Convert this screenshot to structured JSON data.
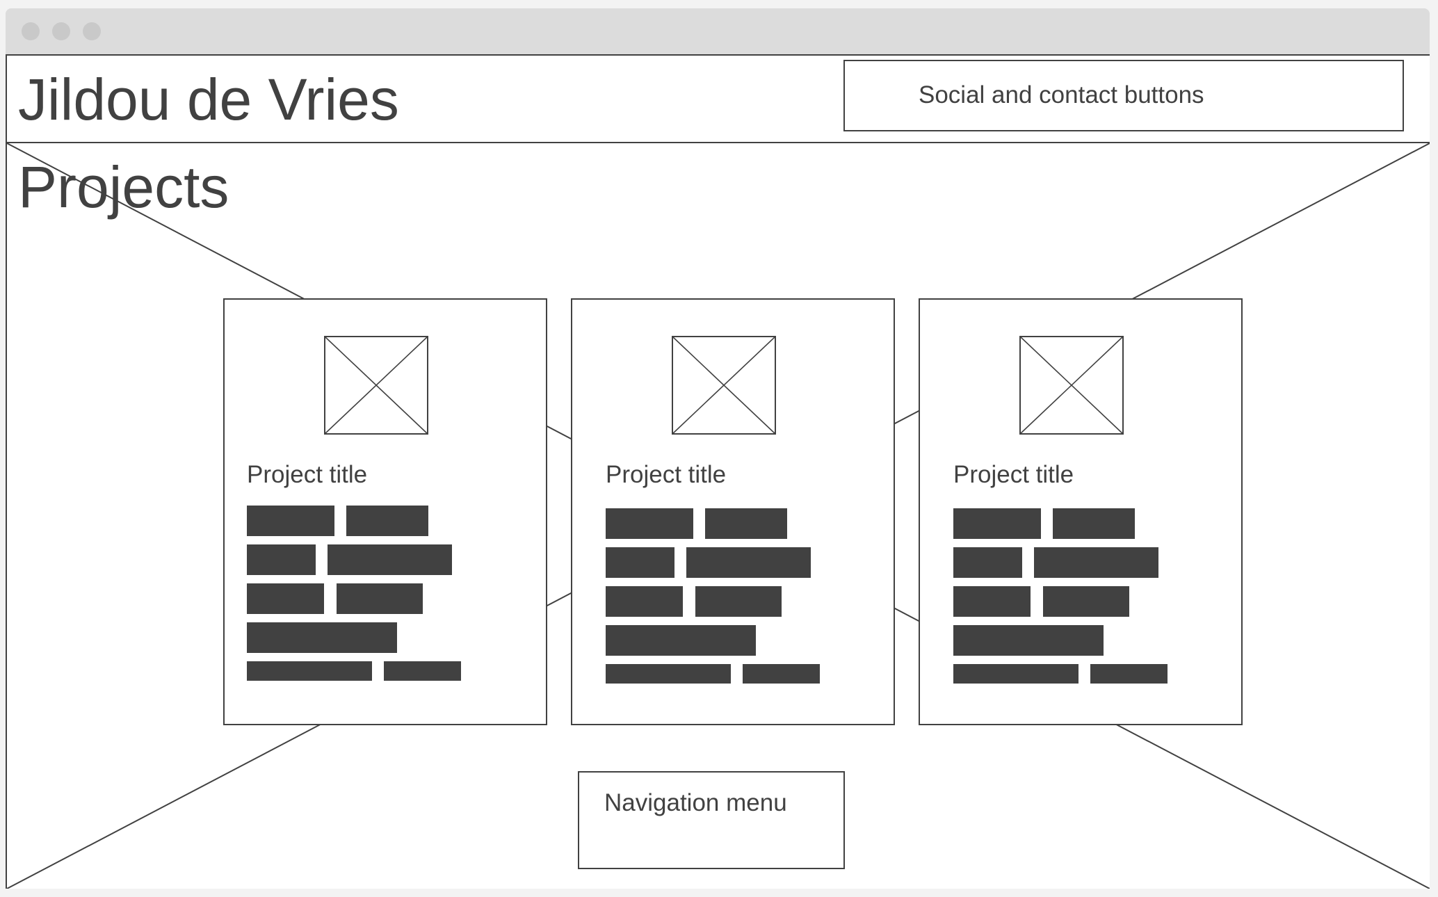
{
  "header": {
    "site_title": "Jildou de Vries",
    "social_label": "Social and contact buttons"
  },
  "section": {
    "title": "Projects"
  },
  "projects": [
    {
      "title": "Project title",
      "image": "image-placeholder-icon"
    },
    {
      "title": "Project title",
      "image": "image-placeholder-icon"
    },
    {
      "title": "Project title",
      "image": "image-placeholder-icon"
    }
  ],
  "nav": {
    "label": "Navigation menu"
  },
  "colors": {
    "ink": "#414141",
    "titlebar": "#dcdcdc",
    "dots": "#c9c9c9",
    "canvas": "#ffffff"
  }
}
